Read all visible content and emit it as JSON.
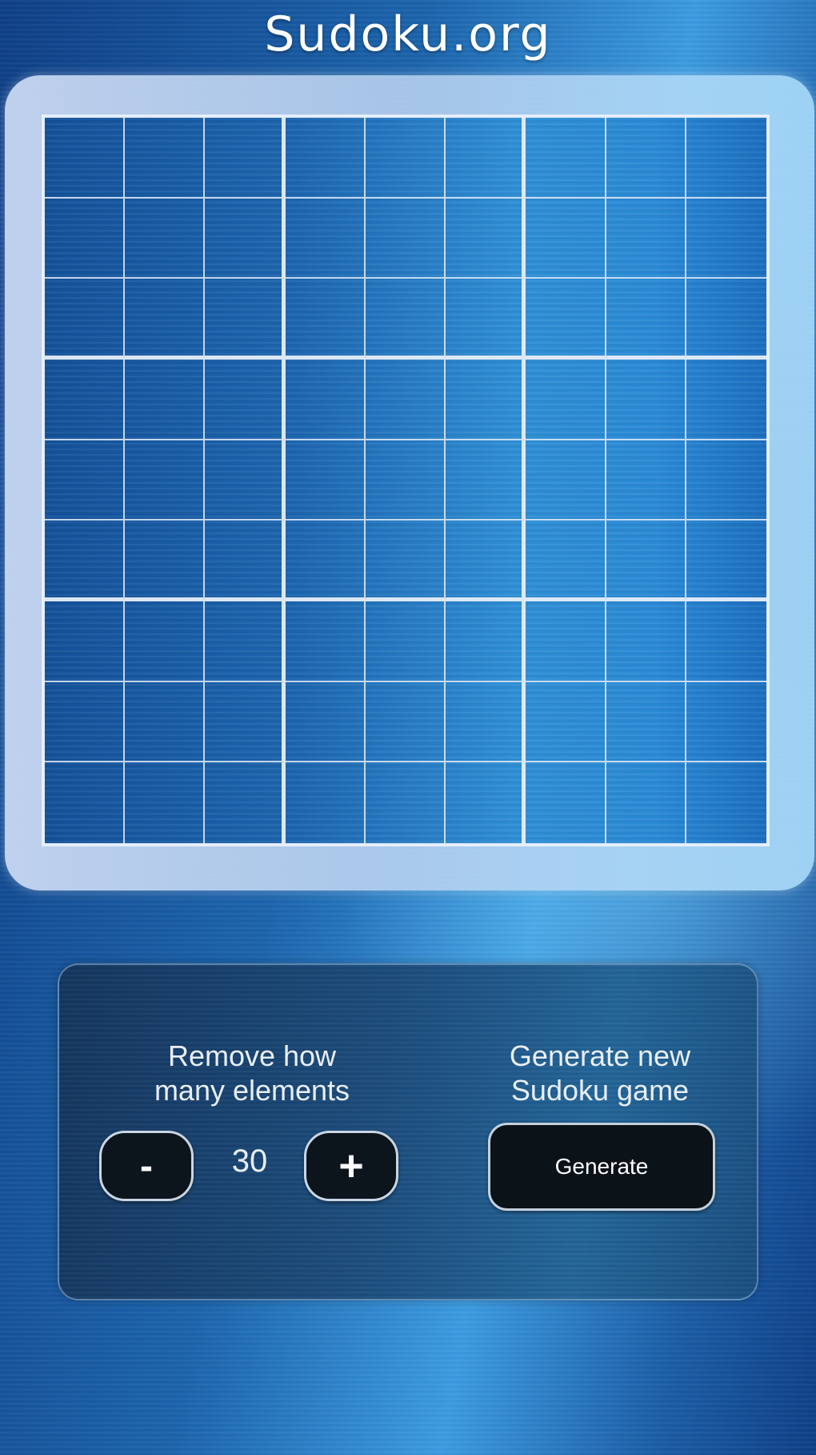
{
  "app": {
    "title": "Sudoku.org"
  },
  "board": {
    "size": 9,
    "cells": [
      [
        "",
        "",
        "",
        "",
        "",
        "",
        "",
        "",
        ""
      ],
      [
        "",
        "",
        "",
        "",
        "",
        "",
        "",
        "",
        ""
      ],
      [
        "",
        "",
        "",
        "",
        "",
        "",
        "",
        "",
        ""
      ],
      [
        "",
        "",
        "",
        "",
        "",
        "",
        "",
        "",
        ""
      ],
      [
        "",
        "",
        "",
        "",
        "",
        "",
        "",
        "",
        ""
      ],
      [
        "",
        "",
        "",
        "",
        "",
        "",
        "",
        "",
        ""
      ],
      [
        "",
        "",
        "",
        "",
        "",
        "",
        "",
        "",
        ""
      ],
      [
        "",
        "",
        "",
        "",
        "",
        "",
        "",
        "",
        ""
      ],
      [
        "",
        "",
        "",
        "",
        "",
        "",
        "",
        "",
        ""
      ]
    ]
  },
  "controls": {
    "remove_label": "Remove how\nmany elements",
    "decrement_label": "-",
    "remove_count": "30",
    "increment_label": "+",
    "generate_heading": "Generate new\nSudoku game",
    "generate_button_label": "Generate"
  },
  "colors": {
    "background_blue": "#1c64ac",
    "frame": "#c8daf2",
    "button_dark": "#0c141c",
    "button_border": "#c9d6e2"
  }
}
